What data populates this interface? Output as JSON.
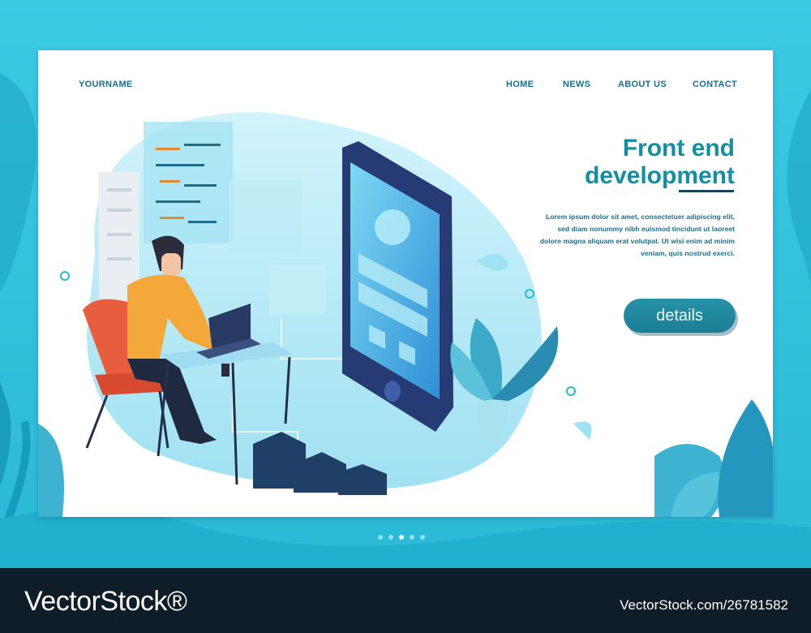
{
  "header": {
    "brand": "YOURNAME",
    "nav": [
      "HOME",
      "NEWS",
      "ABOUT US",
      "CONTACT"
    ]
  },
  "hero": {
    "title_line1": "Front end",
    "title_line2": "development",
    "description": "Lorem ipsum dolor sit amet, consectetuer adipiscing elit, sed diam nonummy nibh euismod tincidunt ut laoreet dolore magna aliquam erat volutpat. Ut wisi enim ad minim veniam, quis nostrud exerci.",
    "button_label": "details"
  },
  "pagination": {
    "count": 5,
    "active_index": 2
  },
  "footer": {
    "watermark_left": "VectorStock®",
    "watermark_right": "VectorStock.com/26781582"
  },
  "colors": {
    "background": "#2bb9d6",
    "accent": "#138fa3",
    "button": "#1b7d93",
    "text": "#1a6f8c",
    "footer": "#0f1d28"
  },
  "icons": [
    "developer-illustration",
    "smartphone-illustration",
    "plant-illustration",
    "server-illustration"
  ]
}
